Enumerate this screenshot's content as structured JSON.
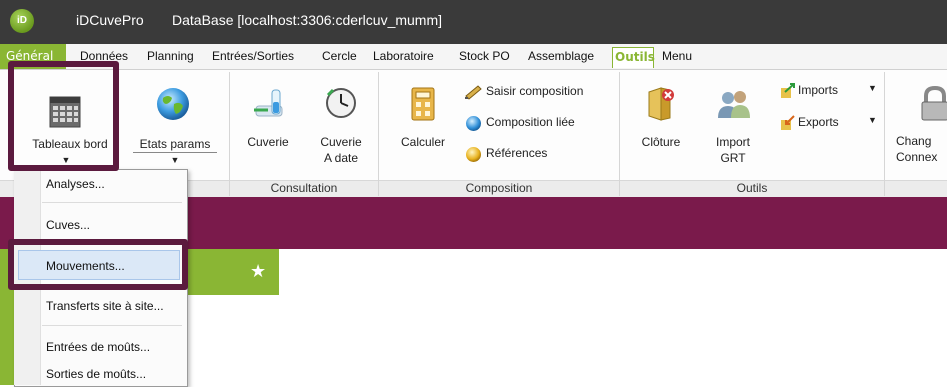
{
  "window": {
    "app_name": "iDCuvePro",
    "logo_text": "iD",
    "database_title": "DataBase [localhost:3306:cderlcuv_mumm]"
  },
  "menu_tabs": [
    {
      "id": "general",
      "label": "Général",
      "active": false
    },
    {
      "id": "donnees",
      "label": "Données"
    },
    {
      "id": "planning",
      "label": "Planning"
    },
    {
      "id": "entrees_sorties",
      "label": "Entrées/Sorties"
    },
    {
      "id": "cercle",
      "label": "Cercle"
    },
    {
      "id": "laboratoire",
      "label": "Laboratoire"
    },
    {
      "id": "stock_po",
      "label": "Stock PO"
    },
    {
      "id": "assemblage",
      "label": "Assemblage"
    },
    {
      "id": "outils",
      "label": "Outils",
      "active": true
    },
    {
      "id": "menu",
      "label": "Menu"
    }
  ],
  "ribbon": {
    "tableaux_bord": "Tableaux bord",
    "etats_params": "Etats params",
    "cuverie": "Cuverie",
    "cuverie_a_date_1": "Cuverie",
    "cuverie_a_date_2": "A date",
    "calculer": "Calculer",
    "saisir_composition": "Saisir composition",
    "composition_liee": "Composition liée",
    "references": "Références",
    "cloture": "Clôture",
    "import_grt_1": "Import",
    "import_grt_2": "GRT",
    "imports": "Imports",
    "exports": "Exports",
    "changer_connexion_1": "Chang",
    "changer_connexion_2": "Connex",
    "groups": {
      "consultation": "Consultation",
      "composition": "Composition",
      "outils": "Outils"
    }
  },
  "dropdown_menu": {
    "items": [
      {
        "label": "Analyses...",
        "mnemonic": "A"
      },
      {
        "label": "Cuves...",
        "mnemonic": "C"
      },
      {
        "label": "Mouvements...",
        "mnemonic": "M",
        "highlighted": true
      },
      {
        "label": "Transferts site à site...",
        "mnemonic": "T"
      },
      {
        "label": "Entrées de moûts...",
        "mnemonic": "E"
      },
      {
        "label": "Sorties de moûts...",
        "mnemonic": "S"
      }
    ]
  },
  "colors": {
    "accent_green": "#8ab634",
    "purple_band": "#7a1a4b",
    "highlight_box": "#5b1a3e",
    "titlebar": "#3a3a3a"
  }
}
